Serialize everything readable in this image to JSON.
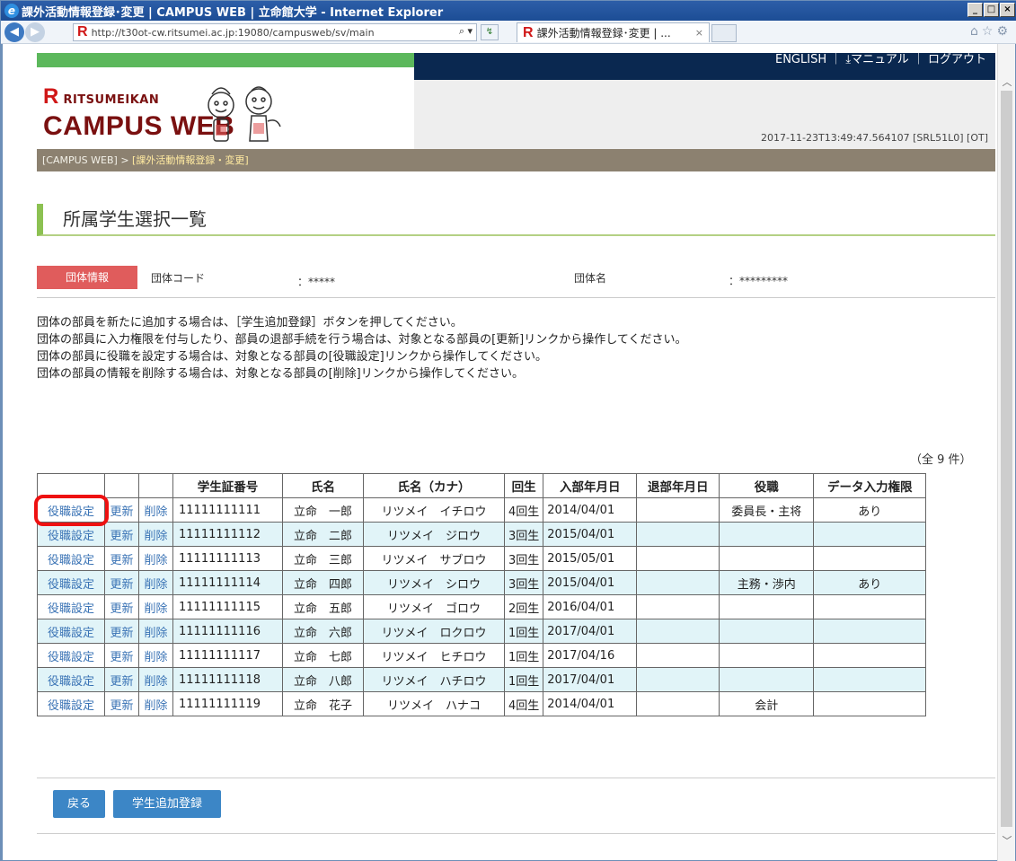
{
  "window": {
    "title": "課外活動情報登録･変更 | CAMPUS WEB | 立命館大学 - Internet Explorer"
  },
  "browser": {
    "url": "http://t30ot-cw.ritsumei.ac.jp:19080/campusweb/sv/main",
    "search_icon": "search-icon",
    "tab_title": "課外活動情報登録･変更 | ...",
    "tab_close": "×"
  },
  "header": {
    "links": "ENGLISH ｜ ⤓マニュアル ｜ ログアウト",
    "logo_top": "RITSUMEIKAN",
    "logo_main": "CAMPUS WEB",
    "timestamp": "2017-11-23T13:49:47.564107 [SRL51L0] [OT]"
  },
  "breadcrumb": {
    "home": "[CAMPUS WEB]",
    "sep": " > ",
    "current": "[課外活動情報登録・変更]"
  },
  "page": {
    "title": "所属学生選択一覧"
  },
  "org": {
    "badge": "団体情報",
    "code_label": "団体コード",
    "code_value": "：*****",
    "name_label": "団体名",
    "name_value": "：*********"
  },
  "notes": [
    "団体の部員を新たに追加する場合は、［学生追加登録］ボタンを押してください。",
    "団体の部員に入力権限を付与したり、部員の退部手続を行う場合は、対象となる部員の[更新]リンクから操作してください。",
    "団体の部員に役職を設定する場合は、対象となる部員の[役職設定]リンクから操作してください。",
    "団体の部員の情報を削除する場合は、対象となる部員の[削除]リンクから操作してください。"
  ],
  "count": "（全 9 件）",
  "table": {
    "headers": [
      "",
      "",
      "",
      "学生証番号",
      "氏名",
      "氏名（カナ）",
      "回生",
      "入部年月日",
      "退部年月日",
      "役職",
      "データ入力権限"
    ],
    "link_labels": {
      "role": "役職設定",
      "update": "更新",
      "delete": "削除"
    },
    "rows": [
      {
        "id": "11111111111",
        "name": "立命　一郎",
        "kana": "リツメイ　イチロウ",
        "year": "4回生",
        "join": "2014/04/01",
        "leave": "",
        "role": "委員長・主将",
        "perm": "あり"
      },
      {
        "id": "11111111112",
        "name": "立命　二郎",
        "kana": "リツメイ　ジロウ",
        "year": "3回生",
        "join": "2015/04/01",
        "leave": "",
        "role": "",
        "perm": ""
      },
      {
        "id": "11111111113",
        "name": "立命　三郎",
        "kana": "リツメイ　サブロウ",
        "year": "3回生",
        "join": "2015/05/01",
        "leave": "",
        "role": "",
        "perm": ""
      },
      {
        "id": "11111111114",
        "name": "立命　四郎",
        "kana": "リツメイ　シロウ",
        "year": "3回生",
        "join": "2015/04/01",
        "leave": "",
        "role": "主務・渉内",
        "perm": "あり"
      },
      {
        "id": "11111111115",
        "name": "立命　五郎",
        "kana": "リツメイ　ゴロウ",
        "year": "2回生",
        "join": "2016/04/01",
        "leave": "",
        "role": "",
        "perm": ""
      },
      {
        "id": "11111111116",
        "name": "立命　六郎",
        "kana": "リツメイ　ロクロウ",
        "year": "1回生",
        "join": "2017/04/01",
        "leave": "",
        "role": "",
        "perm": ""
      },
      {
        "id": "11111111117",
        "name": "立命　七郎",
        "kana": "リツメイ　ヒチロウ",
        "year": "1回生",
        "join": "2017/04/16",
        "leave": "",
        "role": "",
        "perm": ""
      },
      {
        "id": "11111111118",
        "name": "立命　八郎",
        "kana": "リツメイ　ハチロウ",
        "year": "1回生",
        "join": "2017/04/01",
        "leave": "",
        "role": "",
        "perm": ""
      },
      {
        "id": "11111111119",
        "name": "立命　花子",
        "kana": "リツメイ　ハナコ",
        "year": "4回生",
        "join": "2014/04/01",
        "leave": "",
        "role": "会計",
        "perm": ""
      }
    ]
  },
  "buttons": {
    "back": "戻る",
    "add_student": "学生追加登録"
  }
}
